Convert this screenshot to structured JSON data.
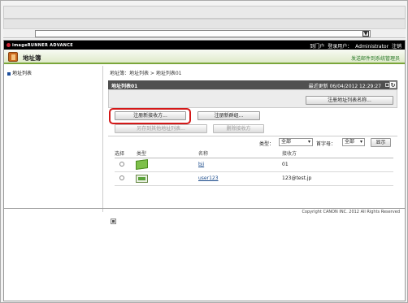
{
  "browser": {
    "address_value": "",
    "address_dropdown": "▼"
  },
  "header": {
    "brand": "imageRUNNER ADVANCE",
    "portal_link": "到门户",
    "login_user_label": "登录用户：",
    "login_user": "Administrator",
    "logout_link": "注销",
    "page_title": "地址簿",
    "mail_link": "发送邮件到系统管理员"
  },
  "sidebar": {
    "items": [
      {
        "label": "地址列表"
      }
    ]
  },
  "content": {
    "breadcrumb": "地址簿：地址列表  >  地址列表01",
    "list_title": "地址列表01",
    "last_updated_label": "最近更新",
    "last_updated_value": "06/04/2012 12:29:27",
    "refresh_icon": "↻",
    "buttons": {
      "register_list_name": "注册地址列表名称...",
      "register_new_destination": "注册新接收方...",
      "register_new_group": "注册新群组...",
      "register_to_other_list": "另存到其他地址列表...",
      "delete_destination": "删除接收方"
    },
    "filter": {
      "type_label": "类型：",
      "type_value": "全部",
      "initial_label": "首字母：",
      "initial_value": "全部",
      "show_button": "显示"
    },
    "table": {
      "columns": [
        "选择",
        "类型",
        "名称",
        "接收方"
      ],
      "rows": [
        {
          "type_icon": "email-icon",
          "name": "bji",
          "destination": "01"
        },
        {
          "type_icon": "file-server-icon",
          "name": "user123",
          "destination": "123@test.jp"
        }
      ]
    },
    "copyright": "Copyright CANON INC. 2012 All Rights Reserved"
  }
}
